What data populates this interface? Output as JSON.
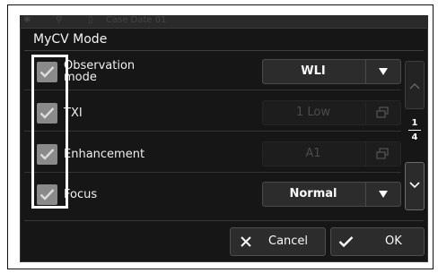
{
  "background": {
    "header_text": "Case Date 01"
  },
  "dialog": {
    "title": "MyCV Mode"
  },
  "rows": [
    {
      "label": "Observation mode",
      "value": "WLI",
      "enabled": true,
      "control": "dropdown",
      "checked": true
    },
    {
      "label": "TXI",
      "value": "1 Low",
      "enabled": false,
      "control": "window",
      "checked": true
    },
    {
      "label": "Enhancement",
      "value": "A1",
      "enabled": false,
      "control": "window",
      "checked": true
    },
    {
      "label": "Focus",
      "value": "Normal",
      "enabled": true,
      "control": "dropdown",
      "checked": true
    }
  ],
  "pager": {
    "current": "1",
    "total": "4"
  },
  "buttons": {
    "cancel": "Cancel",
    "ok": "OK"
  },
  "colors": {
    "dialog_bg": "#161616",
    "checkbox": "#8a8a8a",
    "highlight_frame": "#ffffff"
  }
}
